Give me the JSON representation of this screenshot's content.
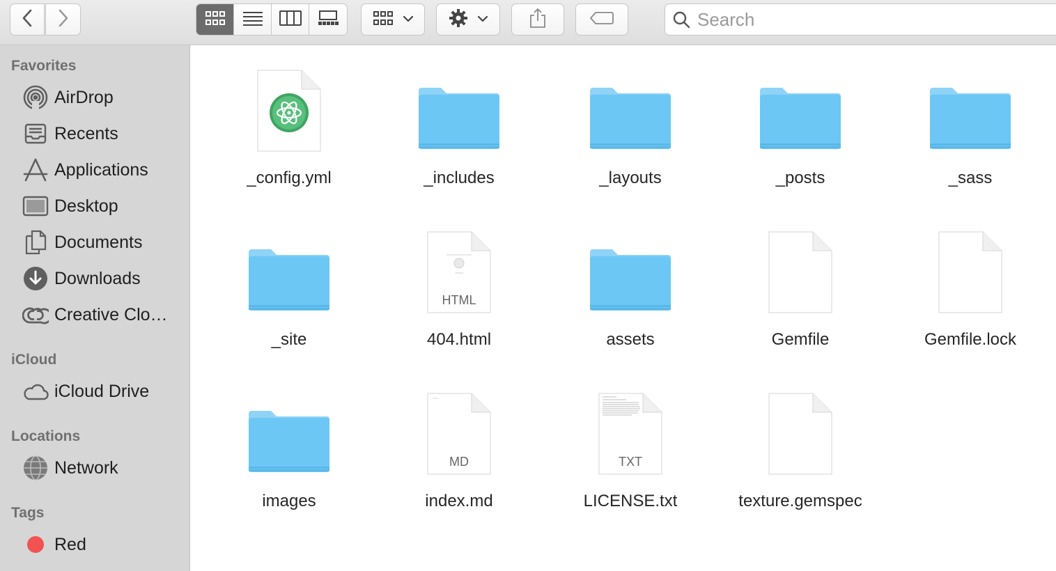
{
  "toolbar": {
    "nav": {
      "back_icon": "chevron-left-icon",
      "forward_icon": "chevron-right-icon"
    },
    "view_modes": [
      "icon-view-icon",
      "list-view-icon",
      "column-view-icon",
      "gallery-view-icon"
    ],
    "active_view": "icon-view-icon",
    "group_icon": "group-grid-icon",
    "action_icon": "gear-icon",
    "share_icon": "share-icon",
    "tag_icon": "tag-icon",
    "search": {
      "placeholder": "Search",
      "value": ""
    }
  },
  "sidebar": {
    "favorites_title": "Favorites",
    "favorites": [
      {
        "label": "AirDrop",
        "icon": "airdrop-icon"
      },
      {
        "label": "Recents",
        "icon": "recents-icon"
      },
      {
        "label": "Applications",
        "icon": "applications-icon"
      },
      {
        "label": "Desktop",
        "icon": "desktop-icon"
      },
      {
        "label": "Documents",
        "icon": "documents-icon"
      },
      {
        "label": "Downloads",
        "icon": "downloads-icon"
      },
      {
        "label": "Creative Clo…",
        "icon": "creative-cloud-icon"
      }
    ],
    "icloud_title": "iCloud",
    "icloud": [
      {
        "label": "iCloud Drive",
        "icon": "cloud-icon"
      }
    ],
    "locations_title": "Locations",
    "locations": [
      {
        "label": "Network",
        "icon": "network-icon"
      }
    ],
    "tags_title": "Tags",
    "tags": [
      {
        "label": "Red",
        "color": "#f25252"
      }
    ]
  },
  "files": [
    {
      "name": "_config.yml",
      "kind": "atom-document"
    },
    {
      "name": "_includes",
      "kind": "folder"
    },
    {
      "name": "_layouts",
      "kind": "folder"
    },
    {
      "name": "_posts",
      "kind": "folder"
    },
    {
      "name": "_sass",
      "kind": "folder"
    },
    {
      "name": "_site",
      "kind": "folder"
    },
    {
      "name": "404.html",
      "kind": "document",
      "badge": "HTML"
    },
    {
      "name": "assets",
      "kind": "folder"
    },
    {
      "name": "Gemfile",
      "kind": "document"
    },
    {
      "name": "Gemfile.lock",
      "kind": "document"
    },
    {
      "name": "images",
      "kind": "folder"
    },
    {
      "name": "index.md",
      "kind": "document",
      "badge": "MD"
    },
    {
      "name": "LICENSE.txt",
      "kind": "document",
      "badge": "TXT"
    },
    {
      "name": "texture.gemspec",
      "kind": "document"
    }
  ],
  "colors": {
    "folder": "#6cc7f5",
    "folder_tab": "#8fd3f7",
    "sidebar_bg": "#d6d6d6",
    "active_segment": "#6c6c6c"
  }
}
